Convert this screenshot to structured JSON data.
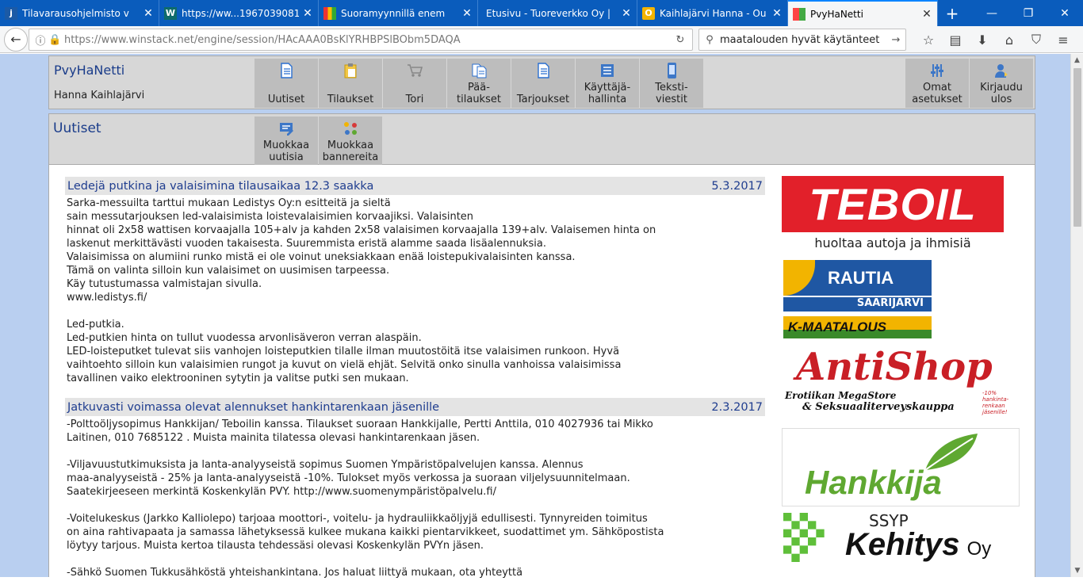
{
  "browser": {
    "tabs": [
      {
        "title": "Tilavarausohjelmisto v",
        "favicon": "j"
      },
      {
        "title": "https://ww...1967039081",
        "favicon": "W"
      },
      {
        "title": "Suoramyynnillä enem",
        "favicon": ""
      },
      {
        "title": "Etusivu - Tuoreverkko Oy |",
        "favicon": ""
      },
      {
        "title": "Kaihlajärvi Hanna - Ou",
        "favicon": "O"
      },
      {
        "title": "PvyHaNetti",
        "favicon": ""
      }
    ],
    "url": "https://www.winstack.net/engine/session/HAcAAA0BsKlYRHBPSlBObm5DAQA",
    "search_query": "maatalouden hyvät käytänteet"
  },
  "header": {
    "brand": "PvyHaNetti",
    "user": "Hanna Kaihlajärvi",
    "menu": [
      {
        "label": "Uutiset",
        "icon": "document-icon"
      },
      {
        "label": "Tilaukset",
        "icon": "clipboard-icon"
      },
      {
        "label": "Tori",
        "icon": "cart-icon"
      },
      {
        "label": "Pää-\ntilaukset",
        "icon": "documents-icon"
      },
      {
        "label": "Tarjoukset",
        "icon": "document-icon"
      },
      {
        "label": "Käyttäjä-\nhallinta",
        "icon": "users-icon"
      },
      {
        "label": "Teksti-\nviestit",
        "icon": "phone-icon"
      }
    ],
    "right_menu": [
      {
        "label": "Omat\nasetukset",
        "icon": "sliders-icon"
      },
      {
        "label": "Kirjaudu\nulos",
        "icon": "logout-icon"
      }
    ]
  },
  "section": {
    "title": "Uutiset",
    "actions": [
      {
        "label": "Muokkaa\nuutisia",
        "icon": "edit-news-icon"
      },
      {
        "label": "Muokkaa\nbannereita",
        "icon": "banners-icon"
      }
    ]
  },
  "news": [
    {
      "title": "Ledejä putkina ja valaisimina tilausaikaa 12.3 saakka",
      "date": "5.3.2017",
      "body": "Sarka-messuilta tarttui mukaan Ledistys Oy:n esitteitä ja sieltä\nsain messutarjouksen led-valaisimista loistevalaisimien korvaajiksi. Valaisinten\nhinnat oli 2x58 wattisen korvaajalla 105+alv ja kahden 2x58 valaisimen korvaajalla 139+alv. Valaisemen hinta on\nlaskenut merkittävästi vuoden takaisesta. Suuremmista eristä alamme saada lisäalennuksia.\nValaisimissa on alumiini runko mistä ei ole voinut uneksiakkaan enää loistepukivalaisinten kanssa.\nTämä on valinta silloin kun valaisimet on uusimisen tarpeessa.\nKäy tutustumassa valmistajan sivulla.\nwww.ledistys.fi/\n\nLed-putkia.\nLed-putkien hinta on tullut vuodessa arvonlisäveron verran alaspäin.\nLED-loisteputket tulevat siis vanhojen loisteputkien tilalle ilman muutostöitä itse valaisimen runkoon. Hyvä\nvaihtoehto silloin kun valaisimien rungot ja kuvut on vielä ehjät. Selvitä onko sinulla vanhoissa valaisimissa\ntavallinen vaiko elektrooninen sytytin ja valitse putki sen mukaan."
    },
    {
      "title": "Jatkuvasti voimassa olevat alennukset hankintarenkaan jäsenille",
      "date": "2.3.2017",
      "body": "-Polttoöljysopimus Hankkijan/ Teboilin kanssa. Tilaukset suoraan Hankkijalle, Pertti Anttila, 010 4027936 tai Mikko\nLaitinen, 010 7685122 . Muista mainita tilatessa olevasi hankintarenkaan jäsen.\n\n-Viljavuustutkimuksista ja lanta-analyyseistä sopimus Suomen Ympäristöpalvelujen kanssa. Alennus\nmaa-analyyseistä - 25% ja lanta-analyyseistä -10%. Tulokset myös verkossa ja suoraan viljelysuunnitelmaan.\nSaatekirjeeseen merkintä Koskenkylän PVY. http://www.suomenympäristöpalvelu.fi/\n\n-Voitelukeskus (Jarkko Kalliolepo) tarjoaa moottori-, voitelu- ja hydrauliikkaöljyjä edullisesti. Tynnyreiden toimitus\non aina rahtivapaata ja samassa lähetyksessä kulkee mukana kaikki pientarvikkeet, suodattimet ym. Sähköpostista\nlöytyy tarjous. Muista kertoa tilausta tehdessäsi olevasi Koskenkylän PVYn jäsen.\n\n-Sähkö Suomen Tukkusähköstä yhteishankintana. Jos haluat liittyä mukaan, ota yhteyttä"
    }
  ],
  "ads": {
    "teboil": {
      "name": "TEBOIL",
      "slogan": "huoltaa autoja ja ihmisiä"
    },
    "rautia": {
      "name": "RAUTIA",
      "place": "SAARIJÄRVI",
      "sub": "K-MAATALOUS"
    },
    "antishop": {
      "name": "AntiShop",
      "line1": "Erotiikan MegaStore",
      "line2": "& Seksuaaliterveyskauppa",
      "offer": "-10% hankinta-renkaan jäsenille!"
    },
    "hankkija": {
      "name": "Hankkija"
    },
    "kehitys": {
      "top": "SSYP",
      "name": "Kehitys",
      "suffix": "Oy"
    }
  },
  "colors": {
    "browser_blue": "#0a5cbc",
    "brand_blue": "#1a3c8a",
    "teboil_red": "#e2202a",
    "rautia_blue": "#1f57a3",
    "hankkija_green": "#5fa831"
  }
}
